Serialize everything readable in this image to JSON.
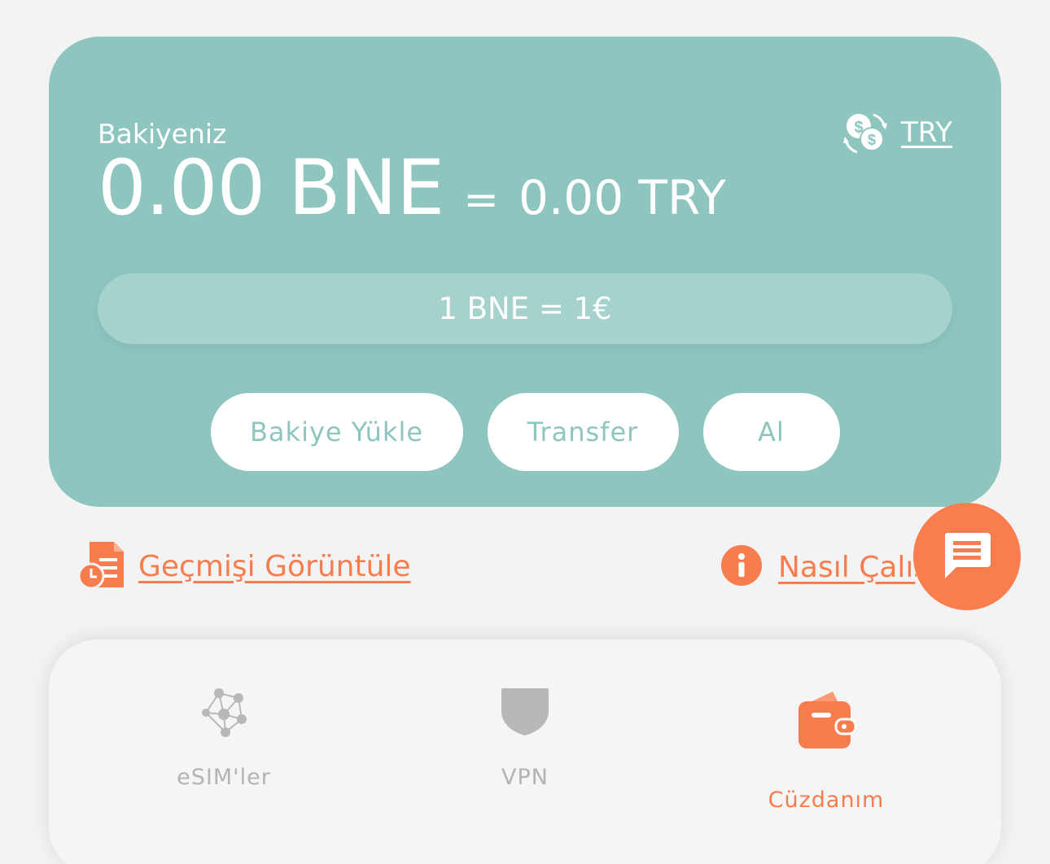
{
  "wallet": {
    "balance_label": "Bakiyeniz",
    "currency": "TRY",
    "balance_main": "0.00 BNE",
    "balance_sep": "=",
    "balance_converted": "0.00 TRY",
    "rate": "1 BNE = 1€",
    "actions": {
      "topup": "Bakiye Yükle",
      "transfer": "Transfer",
      "buy": "Al"
    }
  },
  "links": {
    "history": "Geçmişi Görüntüle",
    "howto": "Nasıl Çalışır"
  },
  "nav": {
    "esim": "eSIM'ler",
    "vpn": "VPN",
    "wallet": "Cüzdanım"
  },
  "colors": {
    "card": "#8ec6bf",
    "accent": "#f77d4e",
    "inactive": "#b3b3b3"
  },
  "icons": {
    "currency": "currency-exchange-icon",
    "history": "history-document-icon",
    "info": "info-icon",
    "chat": "chat-icon",
    "esim": "network-nodes-icon",
    "vpn": "shield-icon",
    "wallet": "wallet-icon"
  }
}
